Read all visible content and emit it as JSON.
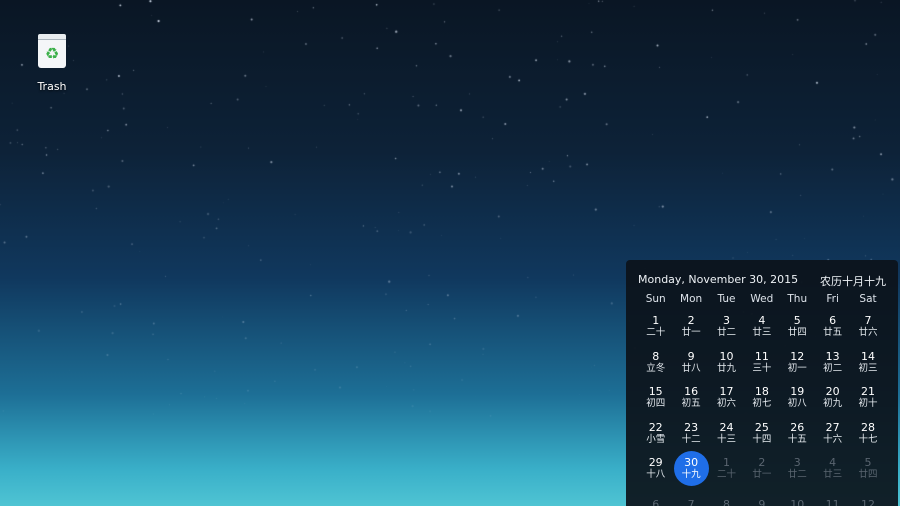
{
  "desktop": {
    "trash_label": "Trash",
    "trash_icon": "trash-icon"
  },
  "calendar": {
    "date_text": "Monday, November 30, 2015",
    "lunar_text": "农历十月十九",
    "selected_color": "#1f6ee8",
    "weekdays": [
      "Sun",
      "Mon",
      "Tue",
      "Wed",
      "Thu",
      "Fri",
      "Sat"
    ],
    "days": [
      {
        "num": "1",
        "lunar": "二十",
        "current": true
      },
      {
        "num": "2",
        "lunar": "廿一",
        "current": true
      },
      {
        "num": "3",
        "lunar": "廿二",
        "current": true
      },
      {
        "num": "4",
        "lunar": "廿三",
        "current": true
      },
      {
        "num": "5",
        "lunar": "廿四",
        "current": true
      },
      {
        "num": "6",
        "lunar": "廿五",
        "current": true
      },
      {
        "num": "7",
        "lunar": "廿六",
        "current": true
      },
      {
        "num": "8",
        "lunar": "立冬",
        "current": true
      },
      {
        "num": "9",
        "lunar": "廿八",
        "current": true
      },
      {
        "num": "10",
        "lunar": "廿九",
        "current": true
      },
      {
        "num": "11",
        "lunar": "三十",
        "current": true
      },
      {
        "num": "12",
        "lunar": "初一",
        "current": true
      },
      {
        "num": "13",
        "lunar": "初二",
        "current": true
      },
      {
        "num": "14",
        "lunar": "初三",
        "current": true
      },
      {
        "num": "15",
        "lunar": "初四",
        "current": true
      },
      {
        "num": "16",
        "lunar": "初五",
        "current": true
      },
      {
        "num": "17",
        "lunar": "初六",
        "current": true
      },
      {
        "num": "18",
        "lunar": "初七",
        "current": true
      },
      {
        "num": "19",
        "lunar": "初八",
        "current": true
      },
      {
        "num": "20",
        "lunar": "初九",
        "current": true
      },
      {
        "num": "21",
        "lunar": "初十",
        "current": true
      },
      {
        "num": "22",
        "lunar": "小雪",
        "current": true
      },
      {
        "num": "23",
        "lunar": "十二",
        "current": true
      },
      {
        "num": "24",
        "lunar": "十三",
        "current": true
      },
      {
        "num": "25",
        "lunar": "十四",
        "current": true
      },
      {
        "num": "26",
        "lunar": "十五",
        "current": true
      },
      {
        "num": "27",
        "lunar": "十六",
        "current": true
      },
      {
        "num": "28",
        "lunar": "十七",
        "current": true
      },
      {
        "num": "29",
        "lunar": "十八",
        "current": true
      },
      {
        "num": "30",
        "lunar": "十九",
        "current": true,
        "selected": true
      },
      {
        "num": "1",
        "lunar": "二十",
        "current": false
      },
      {
        "num": "2",
        "lunar": "廿一",
        "current": false
      },
      {
        "num": "3",
        "lunar": "廿二",
        "current": false
      },
      {
        "num": "4",
        "lunar": "廿三",
        "current": false
      },
      {
        "num": "5",
        "lunar": "廿四",
        "current": false
      },
      {
        "num": "6",
        "lunar": "",
        "current": false
      },
      {
        "num": "7",
        "lunar": "",
        "current": false
      },
      {
        "num": "8",
        "lunar": "",
        "current": false
      },
      {
        "num": "9",
        "lunar": "",
        "current": false
      },
      {
        "num": "10",
        "lunar": "",
        "current": false
      },
      {
        "num": "11",
        "lunar": "",
        "current": false
      },
      {
        "num": "12",
        "lunar": "",
        "current": false
      }
    ]
  }
}
